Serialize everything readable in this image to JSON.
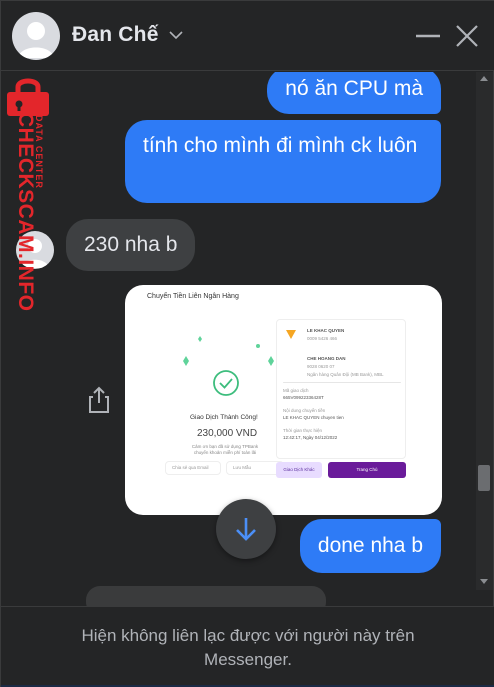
{
  "header": {
    "contact_name": "Đan Chế",
    "icons": [
      "avatar",
      "chevron-down-icon",
      "minimize-icon",
      "close-icon"
    ]
  },
  "messages": [
    {
      "direction": "outgoing",
      "text": "nó ăn CPU mà"
    },
    {
      "direction": "outgoing",
      "text": "tính cho mình đi mình ck luôn"
    },
    {
      "direction": "incoming",
      "text": "230 nha b"
    },
    {
      "direction": "outgoing",
      "type": "image",
      "image": {
        "title": "Chuyển Tiền Liên Ngân Hàng",
        "status": "Giao Dịch Thành Công!",
        "amount": "230,000 VND",
        "note": "Cảm ơn bạn đã sử dụng TPBank chuyển khoản miễn phí toàn lãi",
        "chip_share": "Chia sẻ qua Email",
        "chip_save": "Lưu Mẫu",
        "sender_name": "LE KHAC QUYEN",
        "sender_acc": "0009 5426 466",
        "receiver_name": "CHE HOANG DAN",
        "receiver_acc": "9028 0620 07",
        "receiver_bank": "Ngân hàng Quân Đội (MB Bank), MBL",
        "ref_label": "Mã giao dịch",
        "ref_value": "665V09922336428T",
        "content_label": "Nội dung chuyển tiền",
        "content_value": "LE KHAC QUYEN chuyen tien",
        "time_label": "Thời gian thực hiện",
        "time_value": "12:42:17, Ngày 04/12/2022",
        "btn_secondary": "Giao Dịch Khác",
        "btn_primary": "Trang Chủ"
      }
    },
    {
      "direction": "outgoing",
      "text": "done nha b"
    }
  ],
  "footer": {
    "notice": "Hiện không liên lạc được với người này trên Messenger."
  },
  "watermark": {
    "main": "CHECKSCAM.INFO",
    "sub": "DATA CENTER"
  },
  "colors": {
    "outgoing_bubble": "#2e7bf6",
    "incoming_bubble": "#3e4042",
    "background": "#242526",
    "watermark": "#e3262b"
  }
}
